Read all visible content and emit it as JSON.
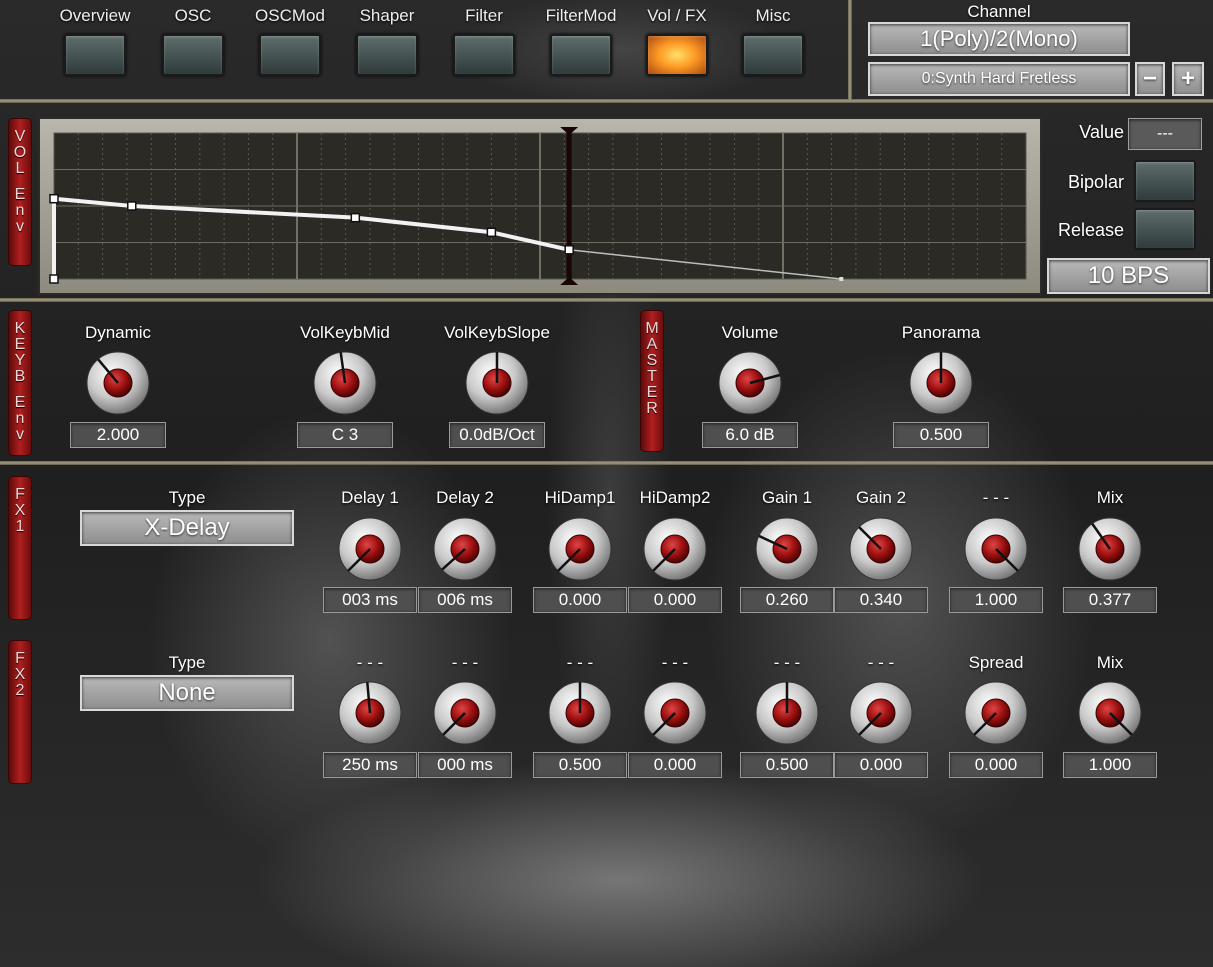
{
  "nav": {
    "tabs": [
      {
        "label": "Overview",
        "active": false
      },
      {
        "label": "OSC",
        "active": false
      },
      {
        "label": "OSCMod",
        "active": false
      },
      {
        "label": "Shaper",
        "active": false
      },
      {
        "label": "Filter",
        "active": false
      },
      {
        "label": "FilterMod",
        "active": false
      },
      {
        "label": "Vol / FX",
        "active": true
      },
      {
        "label": "Misc",
        "active": false
      }
    ]
  },
  "channel": {
    "title": "Channel",
    "mode": "1(Poly)/2(Mono)",
    "preset": "0:Synth Hard Fretless",
    "minus": "−",
    "plus": "+"
  },
  "envelope": {
    "tab_label": [
      "V",
      "O",
      "L",
      " ",
      "E",
      "n",
      "v"
    ],
    "value_label": "Value",
    "value": "---",
    "bipolar_label": "Bipolar",
    "release_label": "Release",
    "rate": "10 BPS",
    "points": [
      {
        "t": 0.0,
        "level": 0.0
      },
      {
        "t": 0.0,
        "level": 0.55
      },
      {
        "t": 0.08,
        "level": 0.5
      },
      {
        "t": 0.31,
        "level": 0.42
      },
      {
        "t": 0.45,
        "level": 0.32
      },
      {
        "t": 0.53,
        "level": 0.2
      },
      {
        "t": 0.81,
        "level": 0.0
      }
    ],
    "release_marker_t": 0.53
  },
  "keyb": {
    "tab_label": [
      "K",
      "E",
      "Y",
      "B",
      " ",
      "E",
      "n",
      "v"
    ],
    "knobs": [
      {
        "label": "Dynamic",
        "value": "2.000",
        "angle": -40
      },
      {
        "label": "VolKeybMid",
        "value": "C 3",
        "angle": -8
      },
      {
        "label": "VolKeybSlope",
        "value": "0.0dB/Oct",
        "angle": 0
      }
    ]
  },
  "master": {
    "tab_label": [
      "M",
      "A",
      "S",
      "T",
      "E",
      "R"
    ],
    "knobs": [
      {
        "label": "Volume",
        "value": "6.0 dB",
        "angle": 75
      },
      {
        "label": "Panorama",
        "value": "0.500",
        "angle": 0
      }
    ]
  },
  "fx1": {
    "tab_label": [
      "F",
      "X",
      "1"
    ],
    "type_label": "Type",
    "type_value": "X-Delay",
    "knobs": [
      {
        "label": "Delay 1",
        "value": "003 ms",
        "angle": -135
      },
      {
        "label": "Delay 2",
        "value": "006 ms",
        "angle": -132
      },
      {
        "label": "HiDamp1",
        "value": "0.000",
        "angle": -135
      },
      {
        "label": "HiDamp2",
        "value": "0.000",
        "angle": -135
      },
      {
        "label": "Gain 1",
        "value": "0.260",
        "angle": -65
      },
      {
        "label": "Gain 2",
        "value": "0.340",
        "angle": -45
      },
      {
        "label": "- - -",
        "value": "1.000",
        "angle": 135
      },
      {
        "label": "Mix",
        "value": "0.377",
        "angle": -35
      }
    ]
  },
  "fx2": {
    "tab_label": [
      "F",
      "X",
      "2"
    ],
    "type_label": "Type",
    "type_value": "None",
    "knobs": [
      {
        "label": "- - -",
        "value": "250 ms",
        "angle": -5
      },
      {
        "label": "- - -",
        "value": "000 ms",
        "angle": -135
      },
      {
        "label": "- - -",
        "value": "0.500",
        "angle": 0
      },
      {
        "label": "- - -",
        "value": "0.000",
        "angle": -135
      },
      {
        "label": "- - -",
        "value": "0.500",
        "angle": 0
      },
      {
        "label": "- - -",
        "value": "0.000",
        "angle": -135
      },
      {
        "label": "Spread",
        "value": "0.000",
        "angle": -135
      },
      {
        "label": "Mix",
        "value": "1.000",
        "angle": 135
      }
    ]
  },
  "colors": {
    "accent_active": "#ff9a24",
    "tab_red": "#b11f1f",
    "knob_red": "#9b0f0f"
  }
}
